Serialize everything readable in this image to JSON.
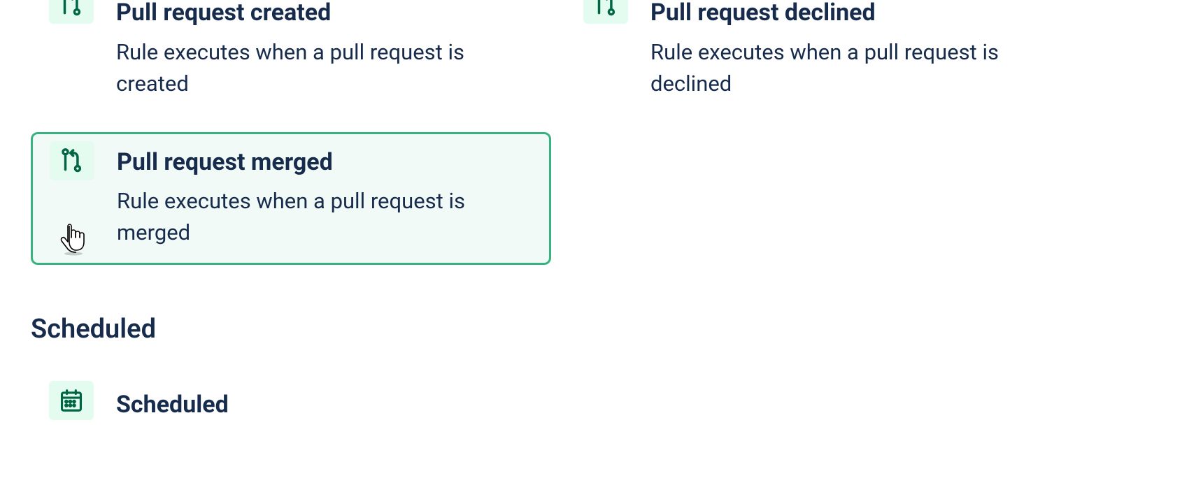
{
  "triggers": {
    "items": [
      {
        "title": "Pull request created",
        "desc": "Rule executes when a pull request is created",
        "icon": "pull-request",
        "selected": false
      },
      {
        "title": "Pull request declined",
        "desc": "Rule executes when a pull request is declined",
        "icon": "pull-request",
        "selected": false
      },
      {
        "title": "Pull request merged",
        "desc": "Rule executes when a pull request is merged",
        "icon": "pull-request",
        "selected": true
      }
    ]
  },
  "sections": {
    "scheduled": {
      "heading": "Scheduled",
      "items": [
        {
          "title": "Scheduled",
          "icon": "calendar"
        }
      ]
    }
  },
  "colors": {
    "accent": "#36b37e",
    "iconBg": "#e3fcef",
    "selectedBg": "#f1faf6",
    "text": "#172b4d",
    "iconStroke": "#006644"
  }
}
